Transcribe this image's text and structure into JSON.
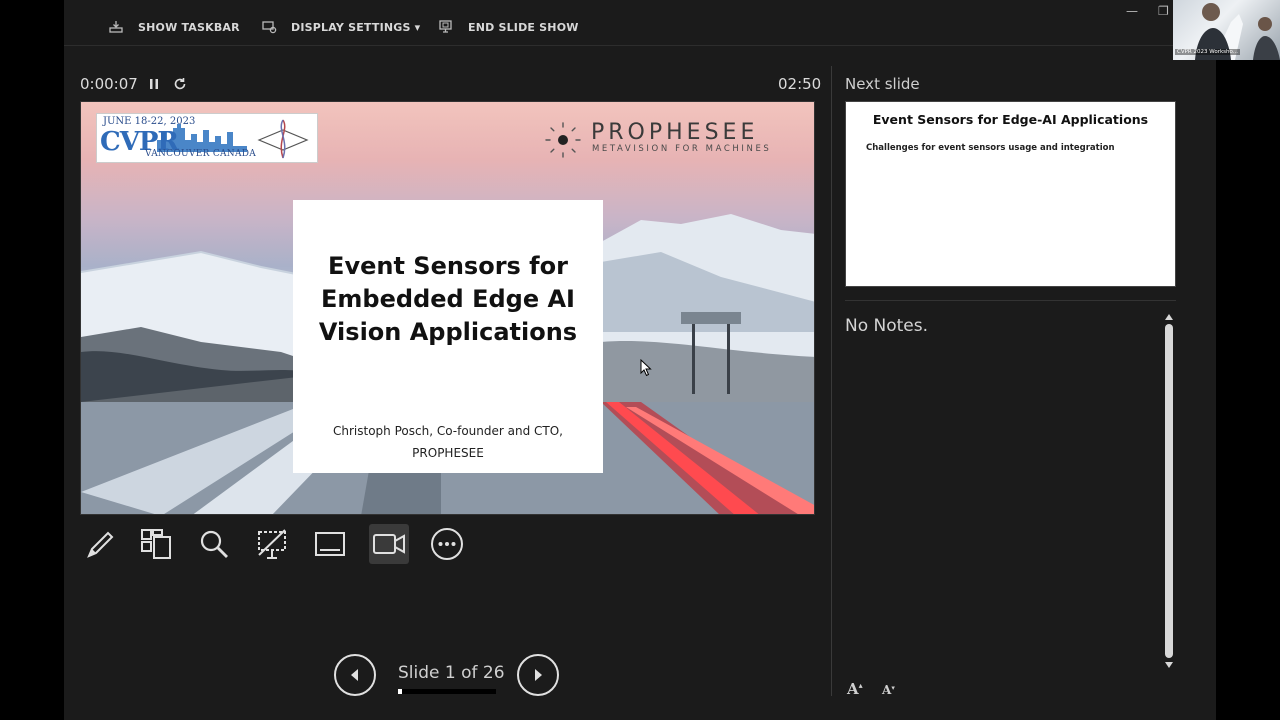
{
  "topbar": {
    "show_taskbar": "SHOW TASKBAR",
    "display_settings": "DISPLAY SETTINGS ▾",
    "end_slide_show": "END SLIDE SHOW"
  },
  "presenter": {
    "elapsed_time": "0:00:07",
    "clock": "02:50"
  },
  "slide": {
    "conference_date": "JUNE 18-22, 2023",
    "conference_name": "CVPR",
    "conference_city": "VANCOUVER CANADA",
    "brand_name": "PROPHESEE",
    "brand_tagline": "METAVISION FOR MACHINES",
    "title_line1": "Event Sensors for",
    "title_line2": "Embedded Edge AI",
    "title_line3": "Vision Applications",
    "author_line1": "Christoph Posch, Co-founder and CTO,",
    "author_line2": "PROPHESEE"
  },
  "tools": {
    "items": [
      "pen-tool",
      "slide-grid",
      "zoom",
      "black-screen",
      "subtitles",
      "camera",
      "more-options"
    ],
    "active": "camera"
  },
  "navigation": {
    "slide_counter": "Slide 1 of 26",
    "progress_fraction": 0.038
  },
  "next_slide": {
    "label": "Next slide",
    "title": "Event Sensors for Edge-AI Applications",
    "body": "Challenges for event sensors usage and integration"
  },
  "notes": {
    "text": "No Notes."
  },
  "font_controls": {
    "increase": "A",
    "decrease": "A"
  },
  "webcam": {
    "label": "CVPR 2023 Worksho..."
  },
  "colors": {
    "window_bg": "#1b1b1b",
    "accent_red": "#e8343a",
    "cvpr_blue": "#2f6bb8"
  }
}
